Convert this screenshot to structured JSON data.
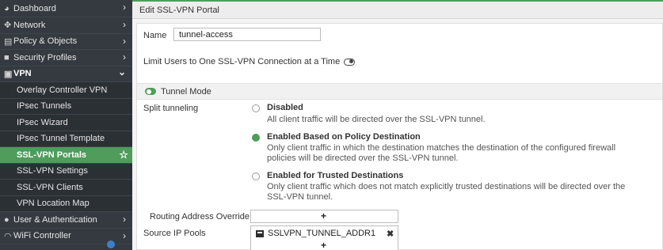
{
  "sidebar": {
    "items": [
      {
        "label": "Dashboard",
        "icon": "dashboard-icon",
        "glyph": "◕",
        "chevron": "›"
      },
      {
        "label": "Network",
        "icon": "network-icon",
        "glyph": "✥",
        "chevron": "›"
      },
      {
        "label": "Policy & Objects",
        "icon": "policy-icon",
        "glyph": "▤",
        "chevron": "›"
      },
      {
        "label": "Security Profiles",
        "icon": "lock-icon",
        "glyph": "■",
        "chevron": "›"
      },
      {
        "label": "VPN",
        "icon": "vpn-icon",
        "glyph": "▣",
        "chevron": "⌄"
      },
      {
        "label": "Overlay Controller VPN"
      },
      {
        "label": "IPsec Tunnels"
      },
      {
        "label": "IPsec Wizard"
      },
      {
        "label": "IPsec Tunnel Template"
      },
      {
        "label": "SSL-VPN Portals",
        "star": "☆"
      },
      {
        "label": "SSL-VPN Settings"
      },
      {
        "label": "SSL-VPN Clients"
      },
      {
        "label": "VPN Location Map"
      },
      {
        "label": "User & Authentication",
        "icon": "user-icon",
        "glyph": "●",
        "chevron": "›"
      },
      {
        "label": "WiFi Controller",
        "icon": "wifi-icon",
        "glyph": "◠",
        "chevron": "›"
      }
    ]
  },
  "header": {
    "title": "Edit SSL-VPN Portal"
  },
  "form": {
    "name_label": "Name",
    "name_value": "tunnel-access",
    "limit_label": "Limit Users to One SSL-VPN Connection at a Time",
    "limit_enabled": false,
    "tunnel_mode_label": "Tunnel Mode",
    "tunnel_mode_enabled": true,
    "split_label": "Split tunneling",
    "options": [
      {
        "title": "Disabled",
        "desc": "All client traffic will be directed over the SSL-VPN tunnel.",
        "selected": false
      },
      {
        "title": "Enabled Based on Policy Destination",
        "desc": "Only client traffic in which the destination matches the destination of the configured firewall policies will be directed over the SSL-VPN tunnel.",
        "selected": true
      },
      {
        "title": "Enabled for Trusted Destinations",
        "desc": "Only client traffic which does not match explicitly trusted destinations will be directed over the SSL-VPN tunnel.",
        "selected": false
      }
    ],
    "routing_label": "Routing Address Override",
    "plus": "+",
    "source_pools_label": "Source IP Pools",
    "source_pools": [
      "SSLVPN_TUNNEL_ADDR1"
    ],
    "remove_glyph": "✖"
  },
  "colors": {
    "accent": "#4f9c5b",
    "sidebar_bg": "#343a40",
    "sub_bg": "#2b3035"
  }
}
